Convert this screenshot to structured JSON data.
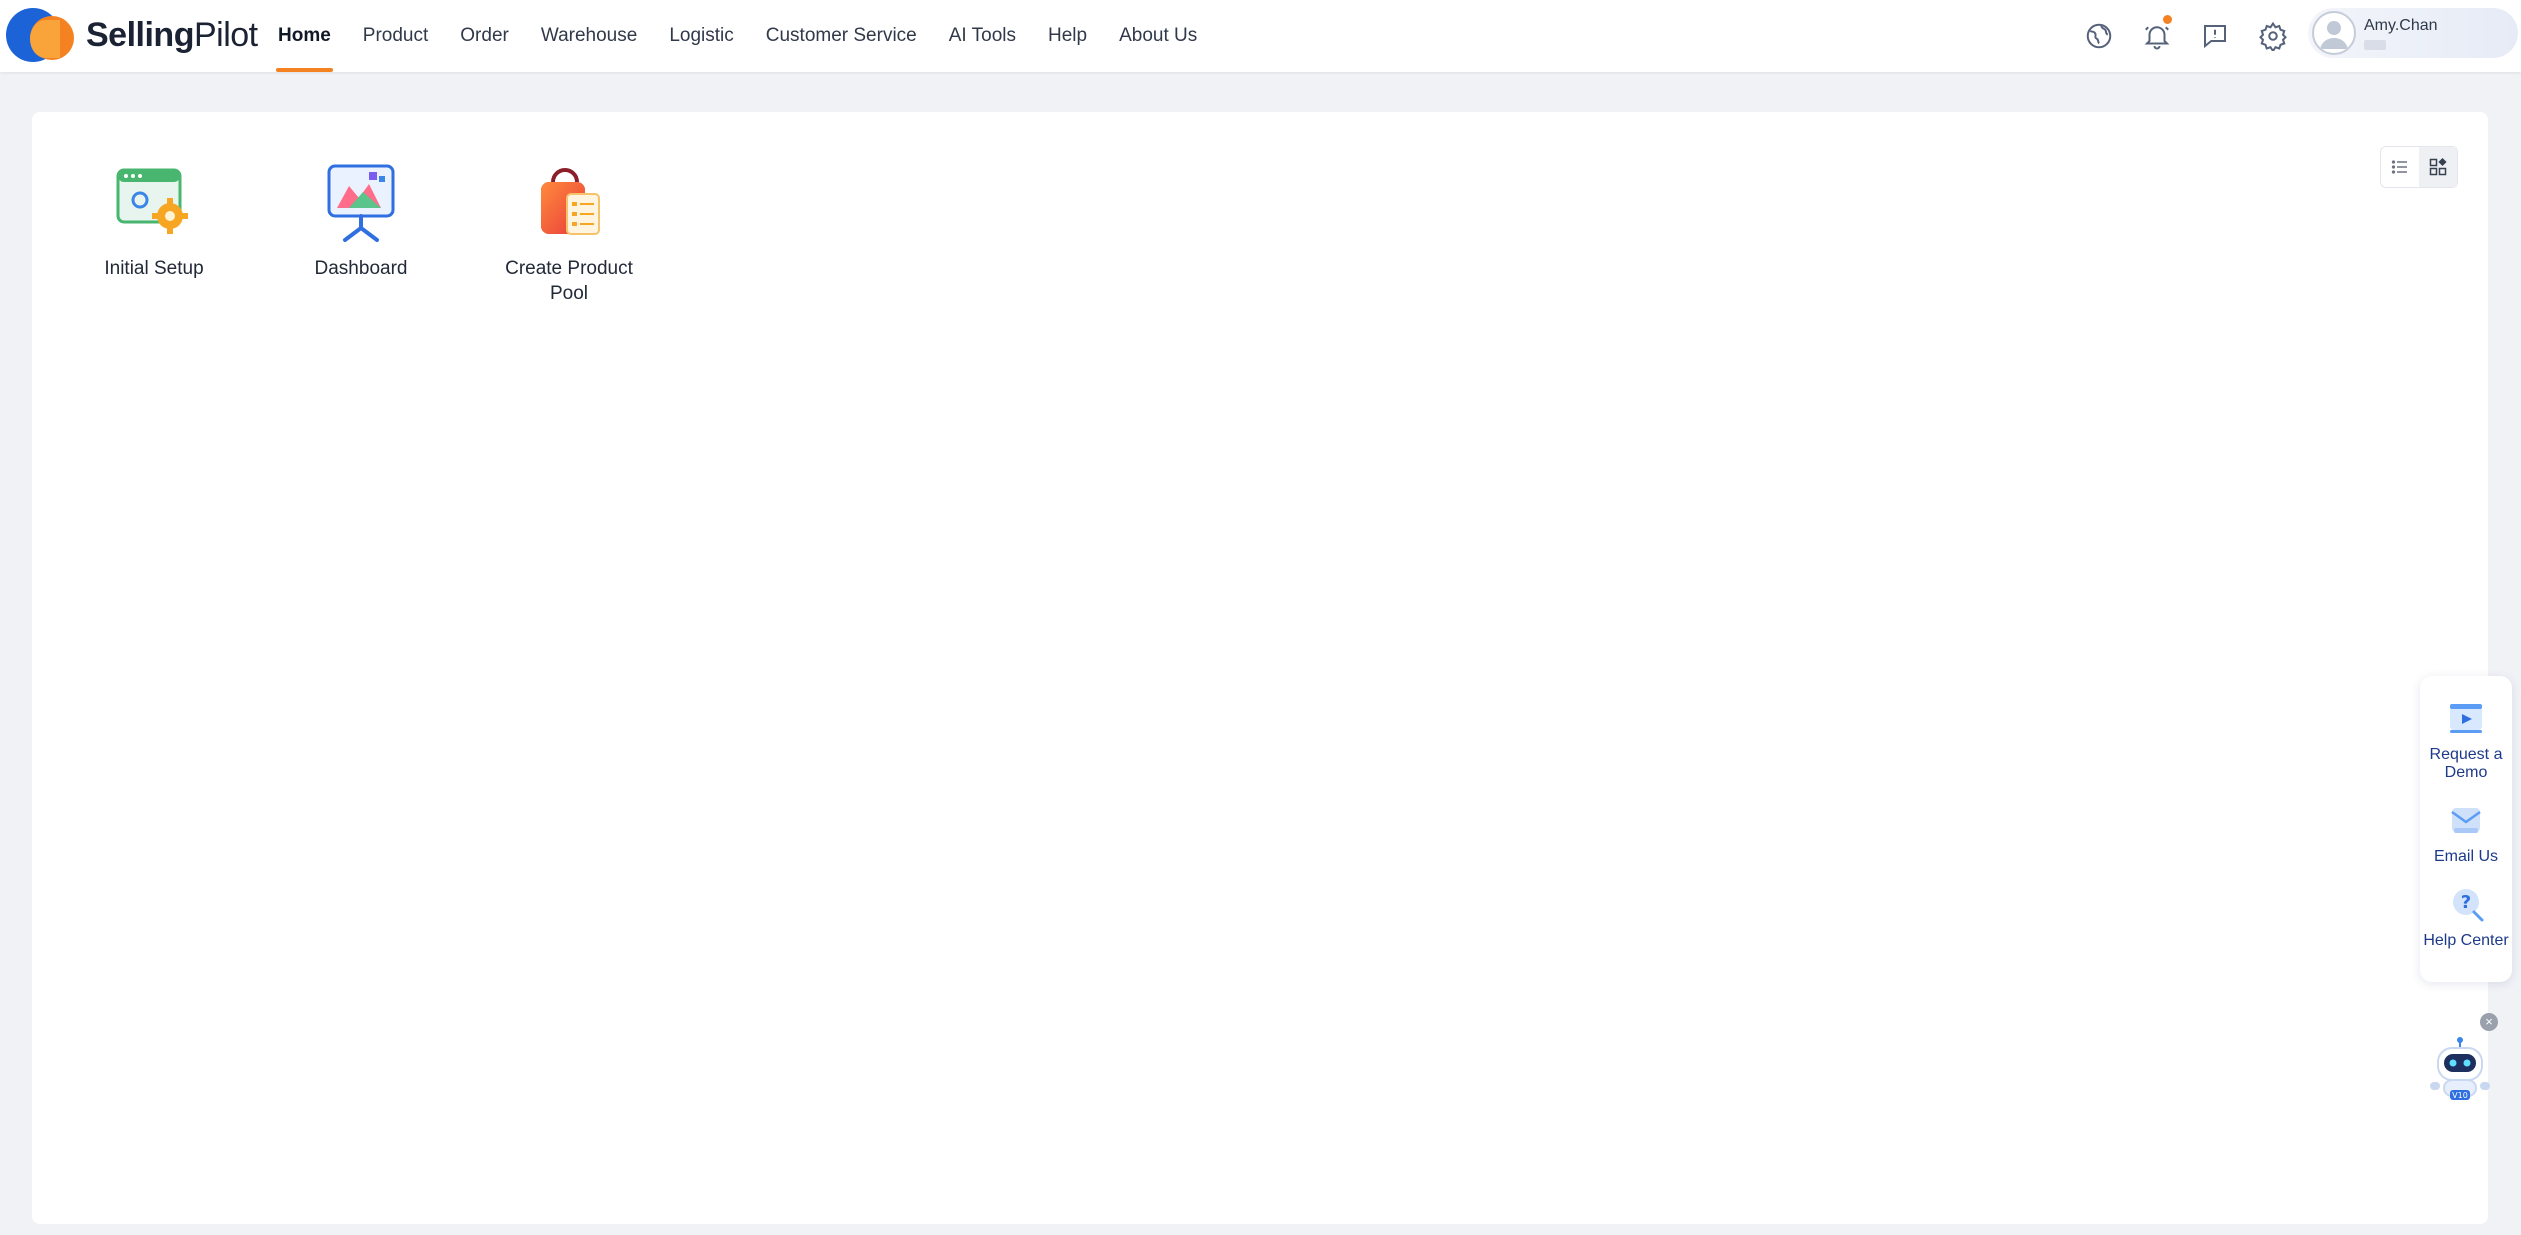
{
  "brand": {
    "name_bold": "Selling",
    "name_light": "Pilot",
    "colors": {
      "primary": "#1b63d6",
      "accent": "#f58220"
    }
  },
  "nav": {
    "items": [
      {
        "label": "Home",
        "active": true
      },
      {
        "label": "Product"
      },
      {
        "label": "Order"
      },
      {
        "label": "Warehouse"
      },
      {
        "label": "Logistic"
      },
      {
        "label": "Customer Service"
      },
      {
        "label": "AI Tools"
      },
      {
        "label": "Help"
      },
      {
        "label": "About Us"
      }
    ]
  },
  "toolbar": {
    "icons": [
      "globe-icon",
      "bell-icon",
      "feedback-icon",
      "gear-icon"
    ],
    "has_notification": true
  },
  "user": {
    "name": "Amy.Chan"
  },
  "view_toggle": {
    "options": [
      "list-view-icon",
      "grid-view-icon"
    ],
    "selected": "grid-view-icon"
  },
  "apps": [
    {
      "label": "Initial Setup",
      "icon": "setup-window-gear-icon"
    },
    {
      "label": "Dashboard",
      "icon": "dashboard-presentation-icon"
    },
    {
      "label": "Create Product Pool",
      "icon": "shopping-bag-list-icon"
    }
  ],
  "help_panel": {
    "items": [
      {
        "label": "Request a Demo",
        "icon": "video-demo-icon"
      },
      {
        "label": "Email Us",
        "icon": "email-icon"
      },
      {
        "label": "Help Center",
        "icon": "help-question-icon"
      }
    ]
  },
  "assistant": {
    "icon": "robot-assistant-icon",
    "badge": "V10"
  }
}
